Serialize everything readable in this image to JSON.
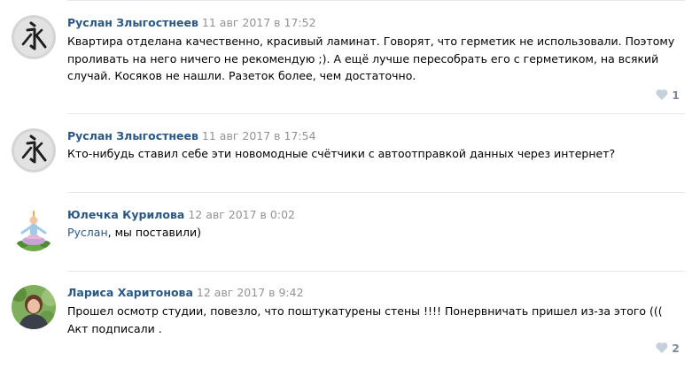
{
  "comments": [
    {
      "author": "Руслан Злыгостнеев",
      "date": "11 авг 2017 в 17:52",
      "text": "Квартира отделана качественно, красивый ламинат. Говорят, что герметик не использовали. Поэтому проливать на него ничего не рекомендую ;). А ещё лучше пересобрать его с герметиком, на всякий случай. Косяков не нашли. Разеток более, чем достаточно.",
      "likes": "1",
      "avatar": "kanji-ei-icon"
    },
    {
      "author": "Руслан Злыгостнеев",
      "date": "11 авг 2017 в 17:54",
      "text": "Кто-нибудь ставил себе эти новомодные счётчики с автоотправкой данных через интернет?",
      "avatar": "kanji-ei-icon"
    },
    {
      "author": "Юлечка Курилова",
      "date": "12 авг 2017 в 0:02",
      "mention": "Руслан",
      "text": ", мы поставили)",
      "avatar": "meditation-figure-icon"
    },
    {
      "author": "Лариса Харитонова",
      "date": "12 авг 2017 в 9:42",
      "text": "Прошел осмотр студии, повезло, что поштукатурены стены !!!! Понервничать пришел из-за этого ((( Акт подписали .",
      "likes": "2",
      "avatar": "photo-portrait-icon"
    }
  ],
  "colors": {
    "author": "#2a5885",
    "date": "#939393",
    "like": "#828a99",
    "divider": "#e7e8ec"
  }
}
